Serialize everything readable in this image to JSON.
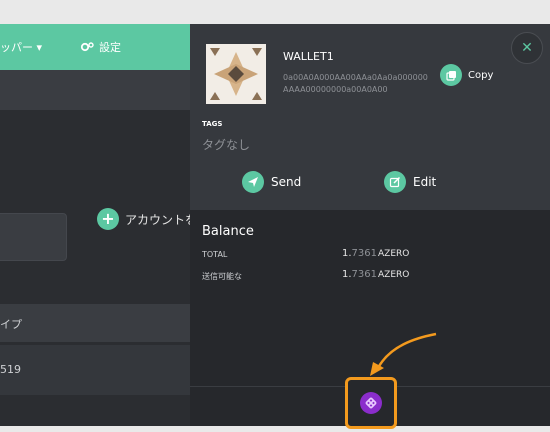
{
  "app": {
    "topbar_member_label": "ッパー ▾",
    "topbar_settings_label": "設定",
    "add_account_label": "アカウントを",
    "row_type_label": "イプ",
    "row_value": "519"
  },
  "wallet": {
    "name": "WALLET1",
    "address": "0a00A0A000AA00AAa0Aa0a000000AAAA00000000a00A0A00",
    "copy_label": "Copy",
    "tags_title": "TAGS",
    "tags_value": "タグなし",
    "send_label": "Send",
    "edit_label": "Edit"
  },
  "balance": {
    "title": "Balance",
    "rows": [
      {
        "label": "TOTAL",
        "amount_int": "1.",
        "amount_dec": "7361",
        "currency": "AZERO"
      },
      {
        "label": "送信可能な",
        "amount_int": "1.",
        "amount_dec": "7361",
        "currency": "AZERO"
      }
    ]
  },
  "colors": {
    "accent": "#5cc8a2",
    "highlight": "#f39a1e",
    "extension_icon": "#8b2dcc"
  }
}
